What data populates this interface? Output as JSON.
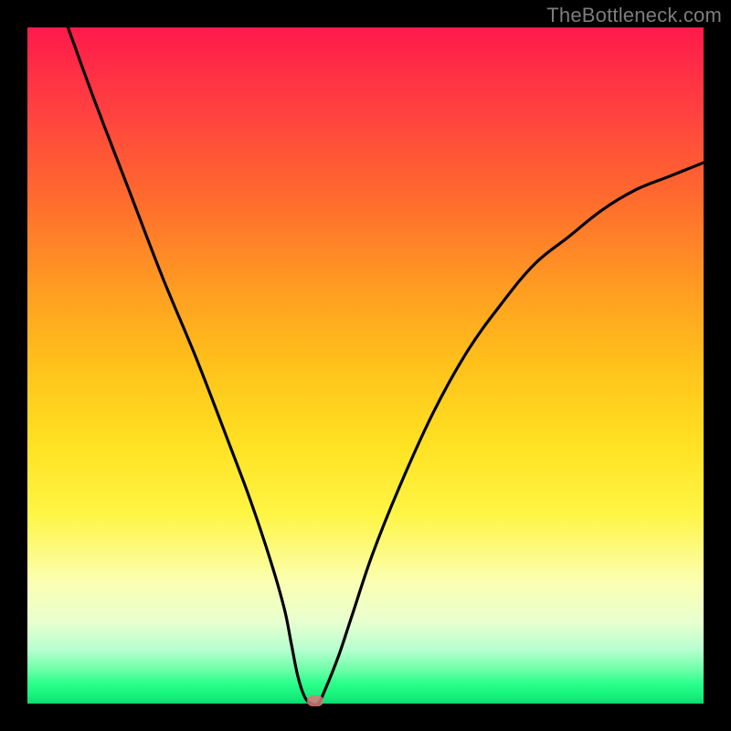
{
  "watermark": "TheBottleneck.com",
  "chart_data": {
    "type": "line",
    "title": "",
    "xlabel": "",
    "ylabel": "",
    "xlim": [
      0,
      100
    ],
    "ylim": [
      0,
      100
    ],
    "grid": false,
    "background": "heat-gradient (red-top to green-bottom)",
    "series": [
      {
        "name": "curve",
        "color": "#000000",
        "x": [
          6,
          10,
          15,
          20,
          25,
          30,
          33,
          36,
          38,
          39,
          40,
          41,
          42,
          43,
          44,
          46,
          48,
          51,
          55,
          60,
          65,
          70,
          75,
          80,
          85,
          90,
          95,
          100
        ],
        "y": [
          100,
          89,
          76,
          63,
          51,
          38,
          30,
          21,
          14,
          9,
          4,
          1,
          0,
          0,
          2,
          7,
          13,
          22,
          32,
          43,
          52,
          59,
          65,
          69,
          73,
          76,
          78,
          80
        ]
      }
    ],
    "marker": {
      "x": 42.5,
      "y": 0,
      "color": "#d67a7a"
    }
  }
}
